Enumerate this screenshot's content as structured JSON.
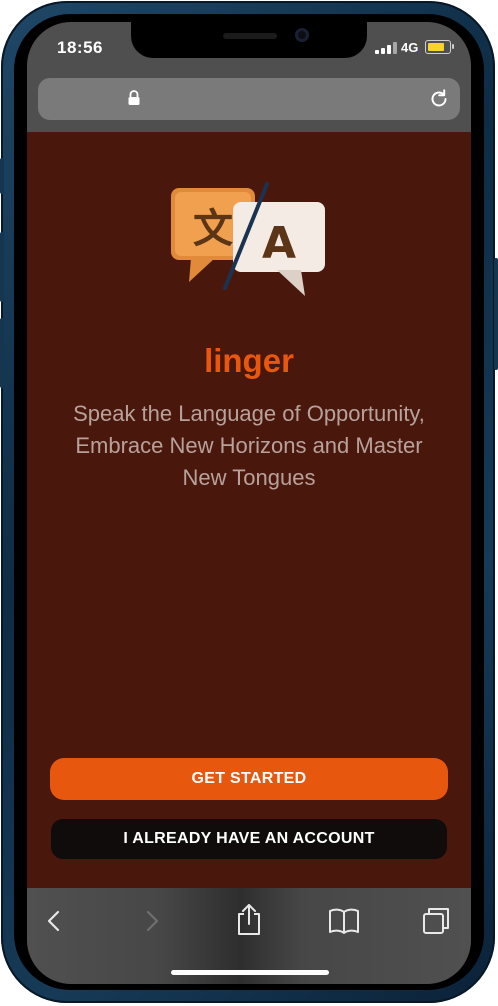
{
  "status_bar": {
    "time": "18:56",
    "network": "4G",
    "battery_level": 0.8,
    "battery_color": "#f7d32b"
  },
  "browser": {
    "lock_icon": "lock-icon",
    "reload_icon": "reload-icon"
  },
  "app": {
    "name": "linger",
    "tagline": "Speak the Language of Opportunity, Embrace New Horizons and Master New Tongues",
    "logo_icon": "translate-icon",
    "accent_color": "#e8570e",
    "background_color": "#4a170d"
  },
  "actions": {
    "get_started": "GET STARTED",
    "have_account": "I ALREADY HAVE AN ACCOUNT"
  },
  "toolbar": {
    "icons": [
      "back-icon",
      "forward-icon",
      "share-icon",
      "bookmarks-icon",
      "tabs-icon"
    ]
  }
}
